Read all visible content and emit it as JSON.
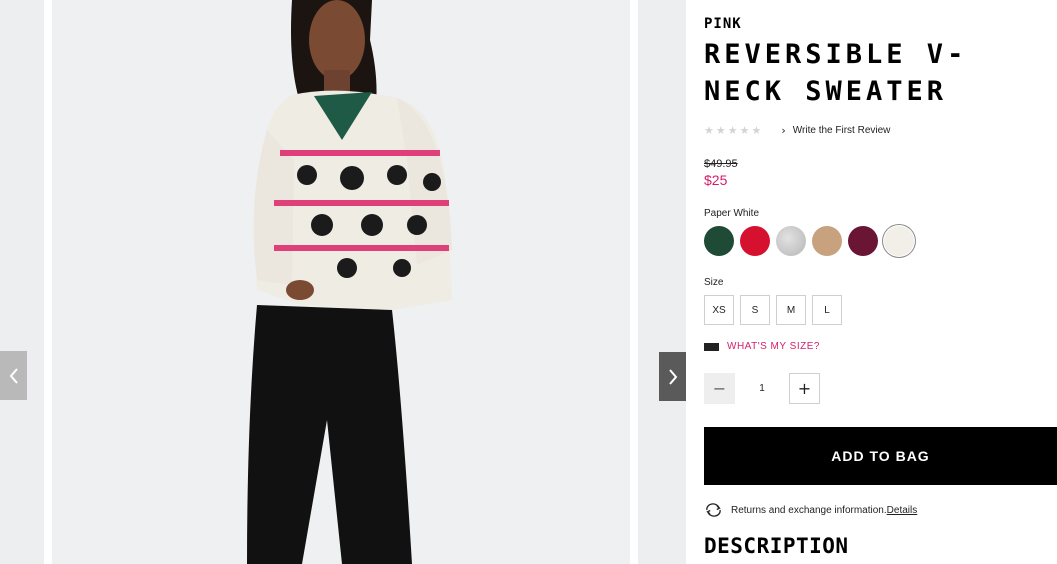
{
  "gallery": {
    "prev_label": "previous image",
    "next_label": "next image"
  },
  "product": {
    "brand": "PINK",
    "title": "REVERSIBLE V-NECK SWEATER",
    "stars": [
      "★",
      "★",
      "★",
      "★",
      "★"
    ],
    "review_link": "Write the First Review",
    "price_original": "$49.95",
    "price_sale": "$25",
    "selected_color": "Paper White",
    "swatches": [
      {
        "name": "green",
        "color": "#1f4a35"
      },
      {
        "name": "red",
        "color": "#d6112f"
      },
      {
        "name": "heather-gray",
        "color": "#c9c9c9"
      },
      {
        "name": "camel",
        "color": "#c8a17e"
      },
      {
        "name": "burgundy",
        "color": "#6a1534"
      },
      {
        "name": "paper-white",
        "color": "#f2efe8"
      }
    ],
    "size_label": "Size",
    "sizes": [
      "XS",
      "S",
      "M",
      "L"
    ],
    "size_guide": "WHAT'S MY SIZE?",
    "quantity": {
      "minus": "−",
      "value": "1",
      "plus": "+"
    },
    "add_to_bag": "ADD TO BAG",
    "returns_text": "Returns and exchange information.",
    "returns_link": "Details",
    "description_heading": "DESCRIPTION"
  },
  "colors": {
    "accent_pink": "#d51e6b",
    "button_black": "#000000"
  }
}
